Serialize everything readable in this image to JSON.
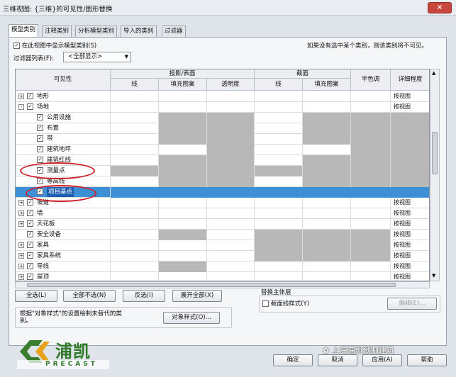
{
  "window": {
    "title": "三维视图: {三维}的可见性/图形替换",
    "close": "×"
  },
  "tabs": [
    "模型类别",
    "注释类别",
    "分析模型类别",
    "导入的类别",
    "过滤器"
  ],
  "panel": {
    "show_model_categories": "在此视图中显示模型类别(S)",
    "hint": "如果没有选中某个类别，则该类别将不可见。",
    "filter_label": "过滤器列表(F):",
    "filter_value": "<全部显示>"
  },
  "table": {
    "headers": {
      "visibility": "可见性",
      "projection": "投影/表面",
      "cut": "截面",
      "halftone": "半色调",
      "detail": "详细程度"
    },
    "subheaders": [
      "线",
      "填充图案",
      "透明度",
      "线",
      "填充图案"
    ],
    "rows": [
      {
        "name": "地形",
        "level": 0,
        "expand": "+",
        "cells": "wwwwwwwh",
        "detail": "按视图"
      },
      {
        "name": "场地",
        "level": 0,
        "expand": "-",
        "cells": "wwwwwwwh",
        "detail": "按视图"
      },
      {
        "name": "公用设施",
        "level": 1,
        "cells": "wggwggggg",
        "detail": ""
      },
      {
        "name": "布置",
        "level": 1,
        "cells": "wggwggggg",
        "detail": ""
      },
      {
        "name": "带",
        "level": 1,
        "cells": "wggwggggg",
        "detail": ""
      },
      {
        "name": "建筑地坪",
        "level": 1,
        "cells": "wwgwwggg",
        "detail": ""
      },
      {
        "name": "建筑红线",
        "level": 1,
        "cells": "wggwggggg",
        "detail": ""
      },
      {
        "name": "测量点",
        "level": 1,
        "cells": "gggggggg",
        "detail": ""
      },
      {
        "name": "等高线",
        "level": 1,
        "cells": "wggwggggg",
        "detail": ""
      },
      {
        "name": "项目基点",
        "level": 1,
        "cells": "sel",
        "detail": ""
      },
      {
        "name": "坡道",
        "level": 0,
        "expand": "+",
        "cells": "wwwwwwwh",
        "detail": "按视图"
      },
      {
        "name": "墙",
        "level": 0,
        "expand": "+",
        "cells": "wwwwwwwh",
        "detail": "按视图"
      },
      {
        "name": "天花板",
        "level": 0,
        "expand": "+",
        "cells": "wwwwwwwh",
        "detail": "按视图"
      },
      {
        "name": "安全设备",
        "level": 0,
        "expand": "",
        "cells": "wgwgggwh",
        "detail": "按视图"
      },
      {
        "name": "家具",
        "level": 0,
        "expand": "+",
        "cells": "wwwgggwh",
        "detail": "按视图"
      },
      {
        "name": "家具系统",
        "level": 0,
        "expand": "+",
        "cells": "wwwgggwh",
        "detail": "按视图"
      },
      {
        "name": "导线",
        "level": 0,
        "expand": "+",
        "cells": "wgwwwwwh",
        "detail": "按视图"
      },
      {
        "name": "屋顶",
        "level": 0,
        "expand": "+",
        "cells": "wwwwwwwh",
        "detail": "按视图"
      }
    ]
  },
  "buttons": {
    "all": "全选(L)",
    "none": "全部不选(N)",
    "invert": "反选(I)",
    "expand_all": "展开全部(X)",
    "edit": "编辑(E)...",
    "object_styles": "对象样式(O)...",
    "ok": "确定",
    "cancel": "取消",
    "apply": "应用(A)",
    "help": "帮助"
  },
  "host_group": {
    "title": "替换主体层",
    "cut_style": "截面线样式(Y)"
  },
  "note": "根据\"对象样式\"的设置绘制未替代的类别。",
  "watermark": {
    "brand": "浦凯",
    "brand_en": "PRECAST",
    "wechat": "上海浦凯预制建筑"
  },
  "colors": {
    "selected_row": "#3d8fd6",
    "gray_cell": "#b8b8b8",
    "red_mark": "#d0202a"
  }
}
